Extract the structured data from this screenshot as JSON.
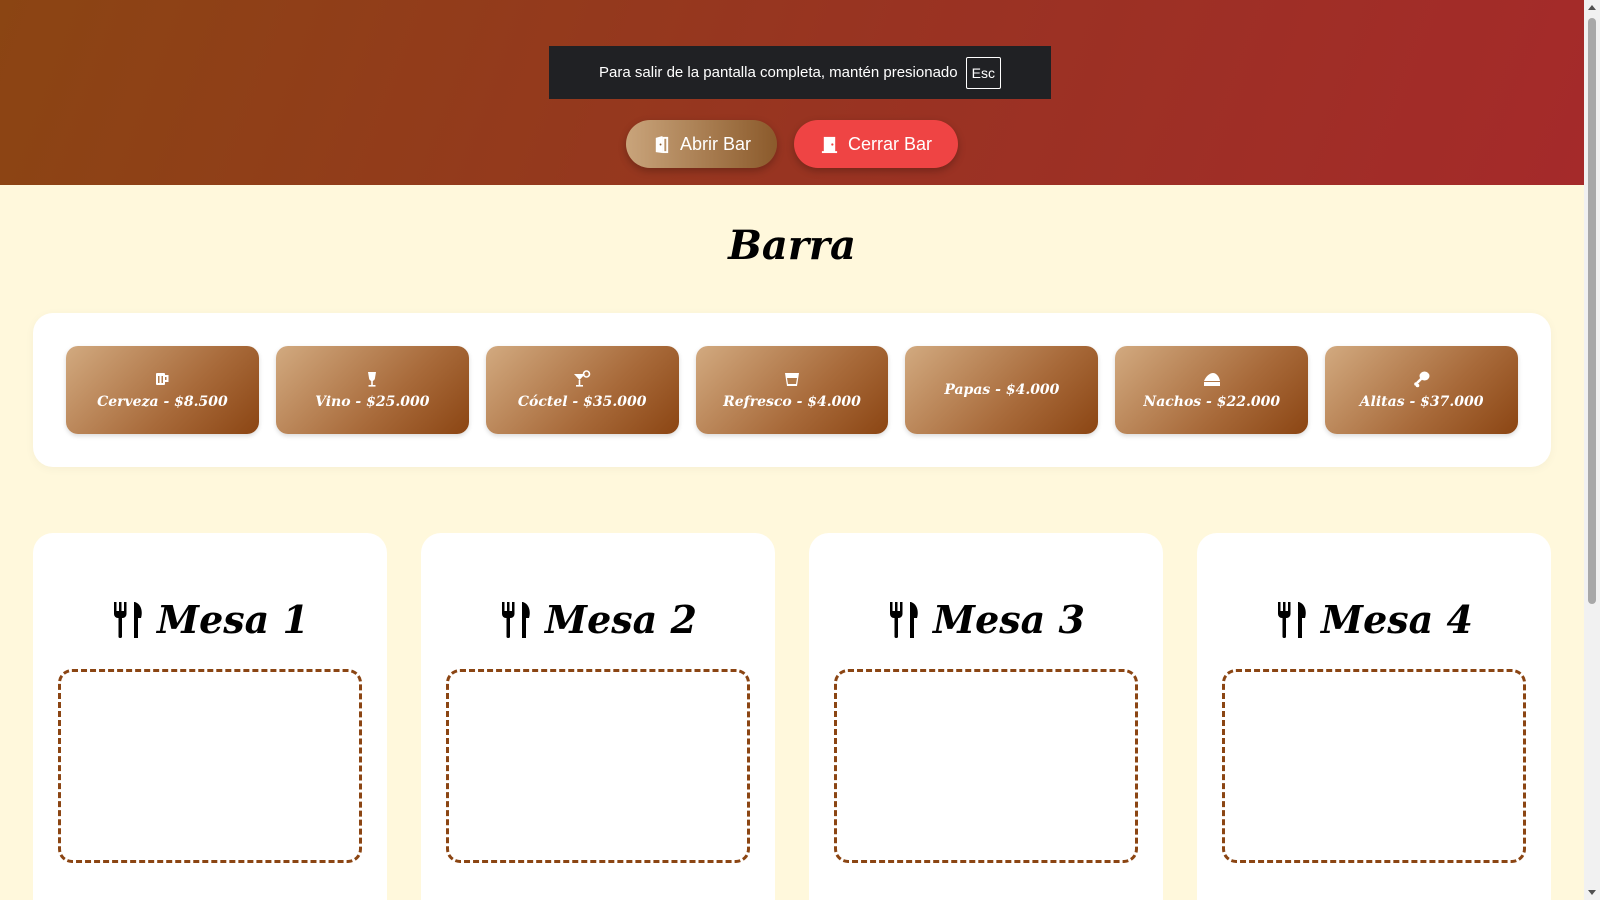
{
  "fullscreen_notice": {
    "text": "Para salir de la pantalla completa, mantén presionado",
    "key": "Esc"
  },
  "header": {
    "open_label": "Abrir Bar",
    "close_label": "Cerrar Bar"
  },
  "bar": {
    "title": "Barra",
    "items": [
      {
        "label": "Cerveza - $8.500",
        "icon": "beer-mug-icon"
      },
      {
        "label": "Vino - $25.000",
        "icon": "wine-glass-icon"
      },
      {
        "label": "Cóctel - $35.000",
        "icon": "cocktail-icon"
      },
      {
        "label": "Refresco - $4.000",
        "icon": "soda-glass-icon"
      },
      {
        "label": "Papas - $4.000",
        "icon": ""
      },
      {
        "label": "Nachos - $22.000",
        "icon": "nachos-icon"
      },
      {
        "label": "Alitas - $37.000",
        "icon": "drumstick-icon"
      }
    ]
  },
  "tables": [
    {
      "title": "Mesa 1"
    },
    {
      "title": "Mesa 2"
    },
    {
      "title": "Mesa 3"
    },
    {
      "title": "Mesa 4"
    }
  ],
  "colors": {
    "header_start": "#8b4513",
    "header_end": "#a52a2a",
    "background": "#fff8dc",
    "close_button": "#ef4444",
    "dropzone_border": "#8b4513"
  }
}
